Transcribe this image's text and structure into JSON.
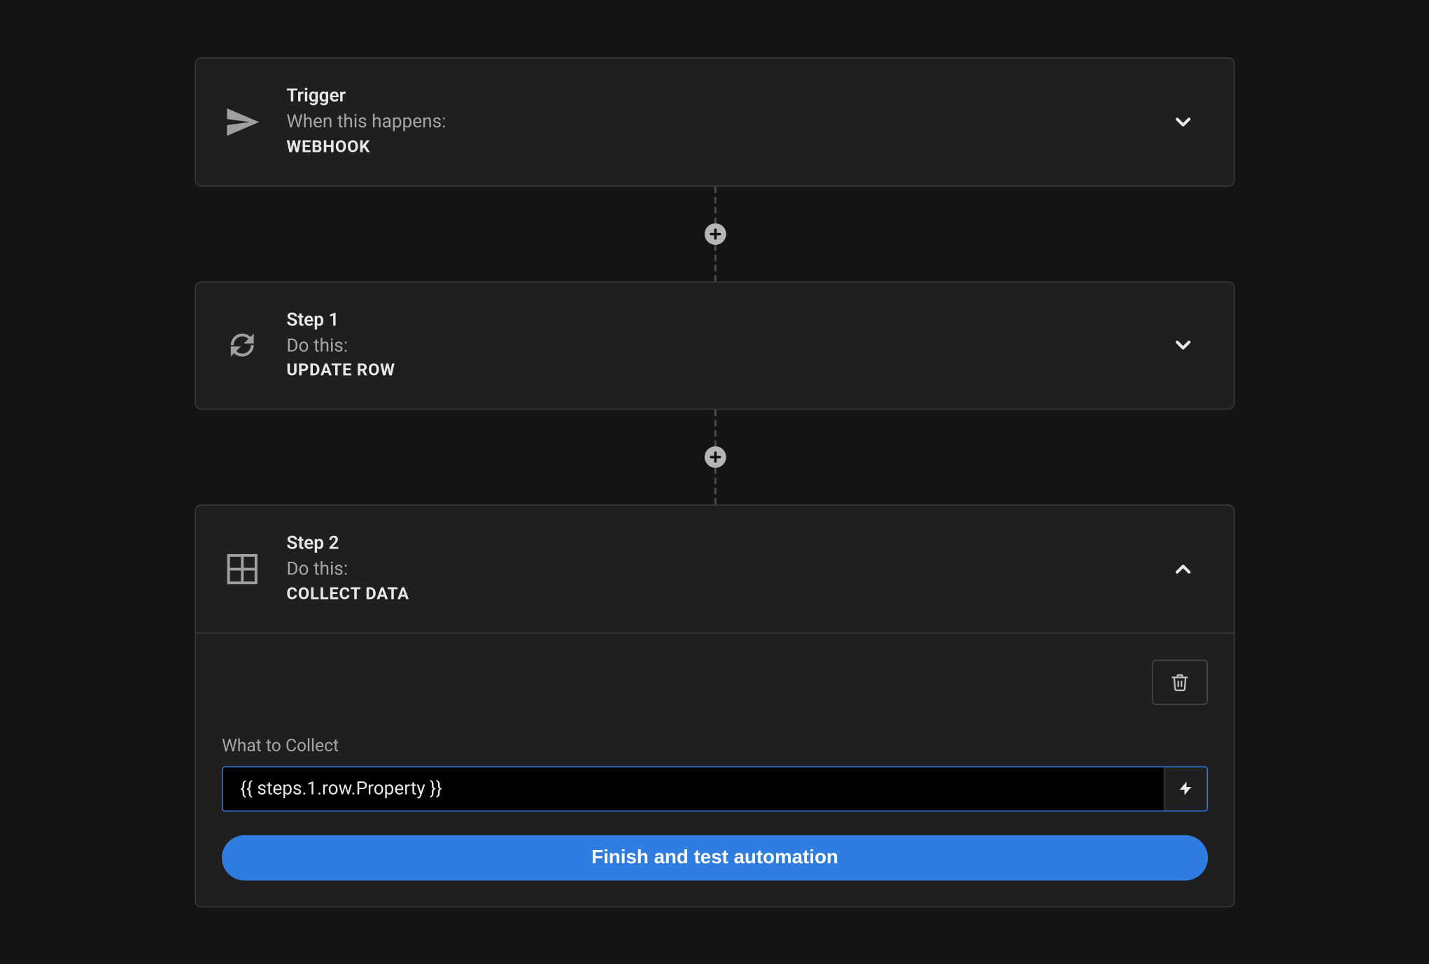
{
  "steps": [
    {
      "title": "Trigger",
      "subtitle": "When this happens:",
      "action": "WEBHOOK",
      "icon": "paper-plane-icon",
      "expanded": false
    },
    {
      "title": "Step 1",
      "subtitle": "Do this:",
      "action": "UPDATE ROW",
      "icon": "refresh-icon",
      "expanded": false
    },
    {
      "title": "Step 2",
      "subtitle": "Do this:",
      "action": "COLLECT DATA",
      "icon": "grid-icon",
      "expanded": true
    }
  ],
  "collect_form": {
    "label": "What to Collect",
    "value": "{{ steps.1.row.Property }}"
  },
  "buttons": {
    "finish": "Finish and test automation"
  }
}
